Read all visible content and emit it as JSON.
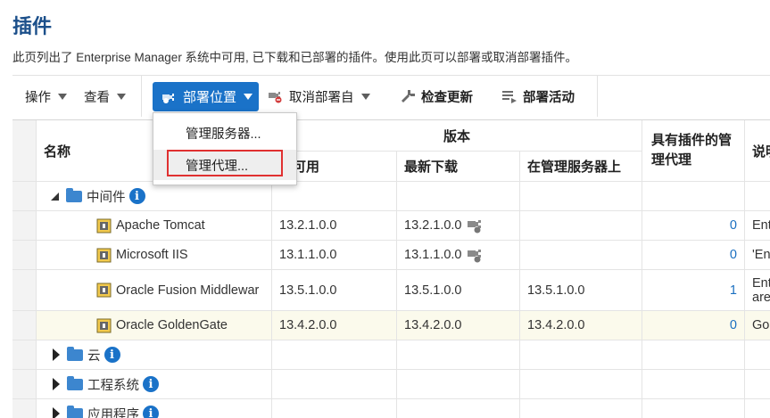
{
  "page": {
    "title": "插件",
    "description": "此页列出了 Enterprise Manager 系统中可用, 已下载和已部署的插件。使用此页可以部署或取消部署插件。"
  },
  "toolbar": {
    "actions_label": "操作",
    "view_label": "查看",
    "deploy_on_label": "部署位置",
    "undeploy_from_label": "取消部署自",
    "check_updates_label": "检查更新",
    "deployment_activities_label": "部署活动"
  },
  "deploy_menu": {
    "items": [
      "管理服务器...",
      "管理代理..."
    ],
    "selected_index": 1
  },
  "table": {
    "headers": {
      "name": "名称",
      "version_group": "版本",
      "latest_available": "新可用",
      "latest_downloaded": "最新下载",
      "on_management_server": "在管理服务器上",
      "management_agent_with_plugin": "具有插件的管理代理",
      "description": "说明"
    },
    "groups": [
      {
        "name": "中间件",
        "expanded": true
      },
      {
        "name": "云",
        "expanded": false
      },
      {
        "name": "工程系统",
        "expanded": false
      },
      {
        "name": "应用程序",
        "expanded": false
      }
    ],
    "rows": [
      {
        "name": "Apache Tomcat",
        "available": "13.2.1.0.0",
        "downloaded": "13.2.1.0.0",
        "on_server": "",
        "agents": "0",
        "desc": "Ent",
        "deployable": true
      },
      {
        "name": "Microsoft IIS",
        "available": "13.1.1.0.0",
        "downloaded": "13.1.1.0.0",
        "on_server": "",
        "agents": "0",
        "desc": "'Ent",
        "deployable": true
      },
      {
        "name": "Oracle Fusion Middlewar",
        "available": "13.5.1.0.0",
        "downloaded": "13.5.1.0.0",
        "on_server": "13.5.1.0.0",
        "agents": "1",
        "desc": "Ent",
        "desc2": "area",
        "deployable": false
      },
      {
        "name": "Oracle GoldenGate",
        "available": "13.4.2.0.0",
        "downloaded": "13.4.2.0.0",
        "on_server": "13.4.2.0.0",
        "agents": "0",
        "desc": "Gol",
        "deployable": false
      }
    ]
  },
  "colors": {
    "title": "#1b4f8a",
    "accent": "#1a72c8",
    "highlight_row": "#fbfaec",
    "selection_border": "#e03030"
  }
}
